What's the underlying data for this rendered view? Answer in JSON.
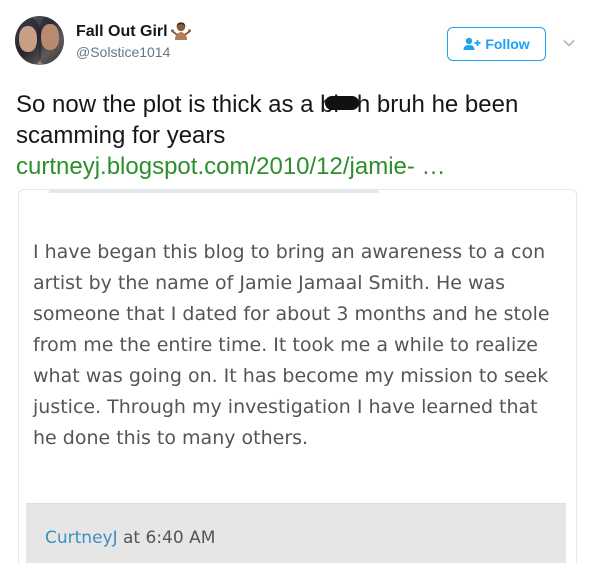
{
  "tweet": {
    "display_name": "Fall Out Girl",
    "handle": "@Solstice1014",
    "name_emoji": "woman-shrug-emoji",
    "follow_label": "Follow",
    "text_part1": "So now the plot is thick as a bi",
    "text_part2": "h bruh he been scamming for years",
    "link": "curtneyj.blogspot.com/2010/12/jamie- …"
  },
  "card": {
    "body": "I have began this blog to bring an awareness to a con artist by the name of Jamie Jamaal Smith. He was someone that I dated for about 3 months and he stole from me the entire time. It took me a while to realize what was going on. It has become my mission to seek justice. Through my investigation I have learned that he done this to many others.",
    "author": "CurtneyJ",
    "at_word": "at",
    "time": "6:40 AM"
  },
  "colors": {
    "follow_blue": "#1da1f2",
    "link_green": "#2c8f2c",
    "author_blue": "#3b8fc2"
  }
}
